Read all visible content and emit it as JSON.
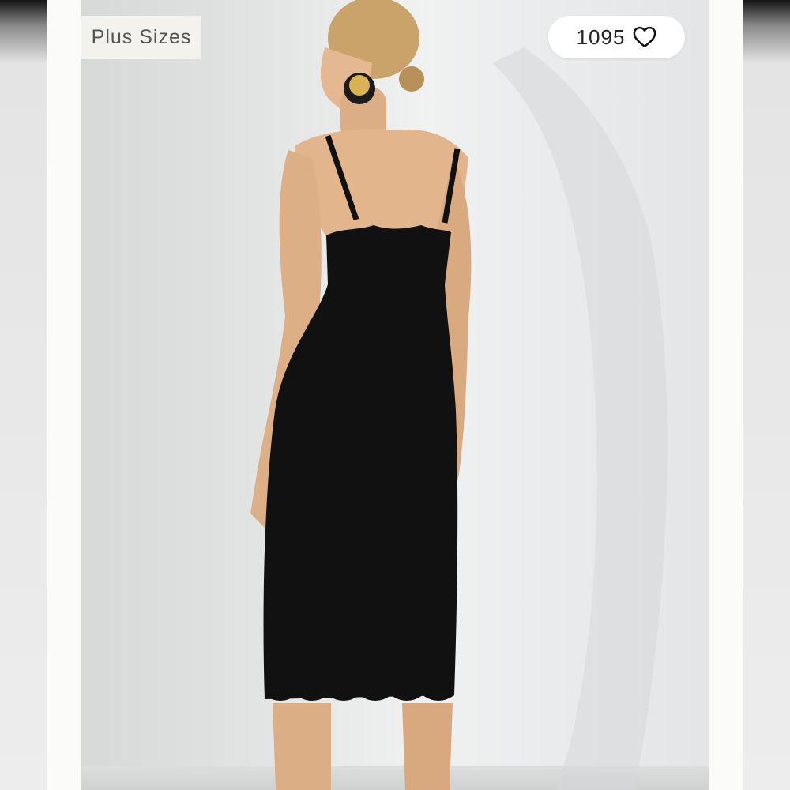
{
  "listing": {
    "badge_label": "Plus Sizes",
    "like_count": "1095",
    "like_icon": "heart-outline-icon"
  },
  "photo": {
    "subject": "product-photo"
  },
  "colors": {
    "background": "#ececec",
    "matte": "#fbfbf9",
    "dress": "#111111",
    "pill": "#ffffff"
  }
}
